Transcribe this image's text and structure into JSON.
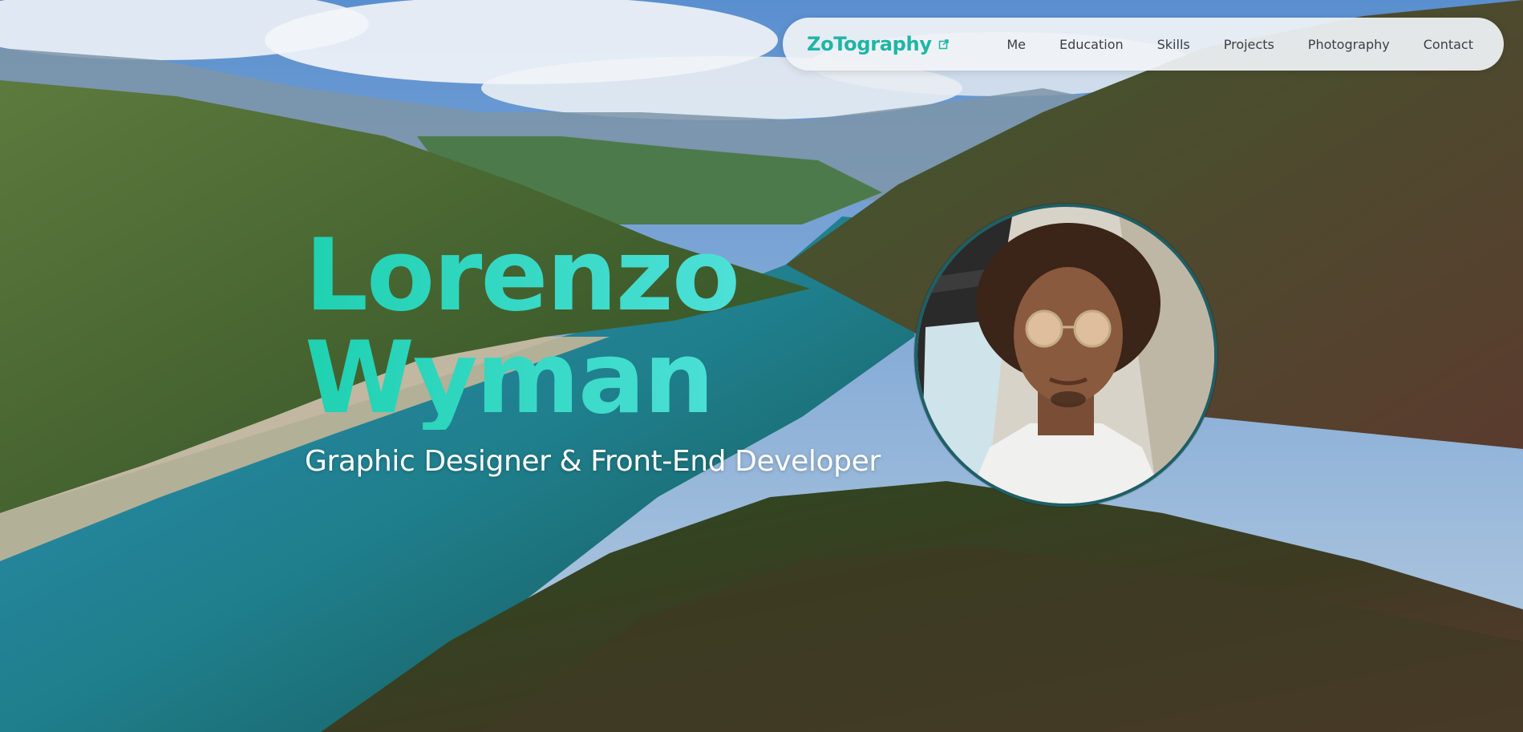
{
  "nav": {
    "brand": "ZoTography",
    "brand_icon": "external-link-icon",
    "links": [
      "Me",
      "Education",
      "Skills",
      "Projects",
      "Photography",
      "Contact"
    ]
  },
  "hero": {
    "first_name": "Lorenzo",
    "last_name": "Wyman",
    "subtitle": "Graphic Designer & Front-End Developer",
    "background_image": "mountain-lake-valley",
    "avatar_image": "profile-photo"
  },
  "colors": {
    "accent": "#1fd1b1",
    "brand": "#1fb5a6",
    "nav_bg": "#f0f3f6",
    "nav_text": "#3b3f44",
    "avatar_ring": "#1d5f66"
  }
}
